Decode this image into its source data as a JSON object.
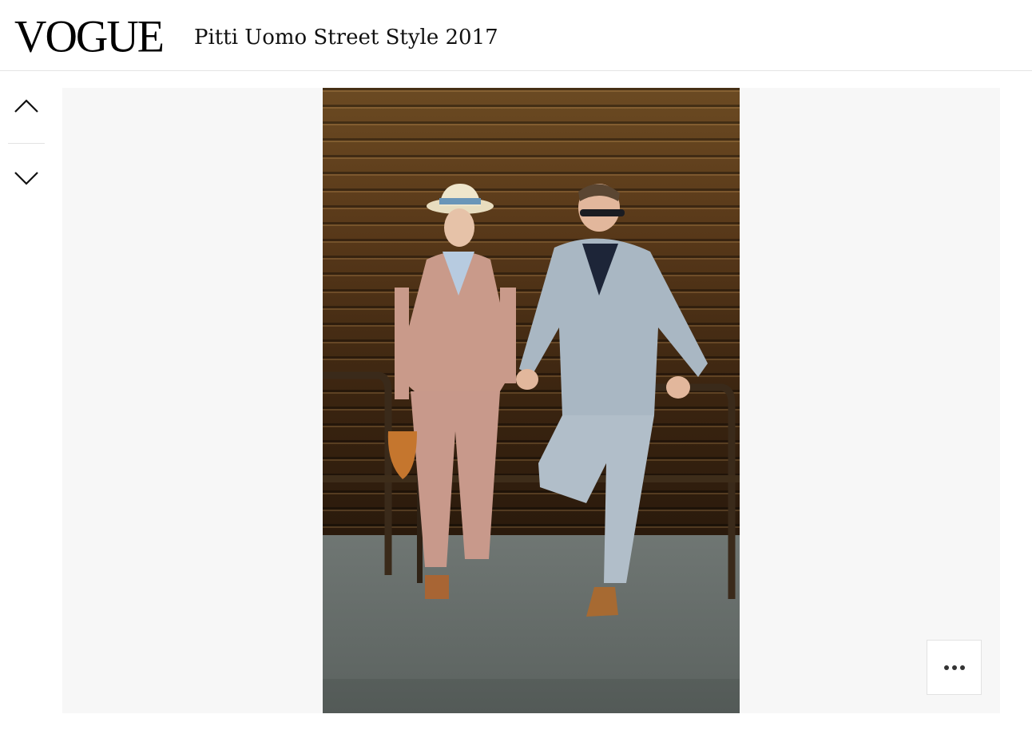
{
  "header": {
    "logo": "VOGUE",
    "title": "Pitti Uomo Street Style 2017"
  },
  "nav": {
    "prev_icon": "chevron-up-icon",
    "next_icon": "chevron-down-icon"
  },
  "slide": {
    "image_alt": "Two people in light suits leaning on a metal railing in front of a brown slatted wall"
  },
  "actions": {
    "more_icon": "more-horizontal-icon"
  },
  "colors": {
    "stage_bg": "#f7f7f7",
    "header_border": "#e4e4e4",
    "text": "#111111"
  }
}
